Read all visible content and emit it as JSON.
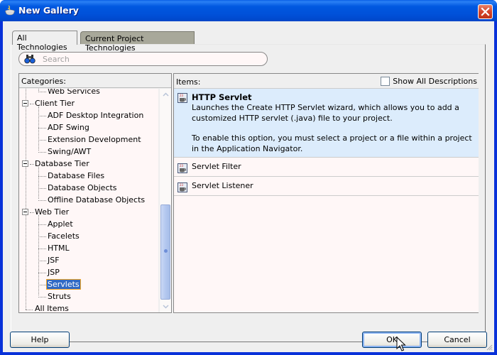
{
  "window": {
    "title": "New Gallery",
    "close_label": "close"
  },
  "tabs": [
    {
      "label": "All Technologies",
      "active": true
    },
    {
      "label": "Current Project Technologies",
      "active": false
    }
  ],
  "search": {
    "placeholder": "Search",
    "value": ""
  },
  "categories": {
    "header": "Categories:",
    "items": [
      {
        "label": "Web Services",
        "level": 1
      },
      {
        "label": "Client Tier",
        "level": 0,
        "expanded": true
      },
      {
        "label": "ADF Desktop Integration",
        "level": 1
      },
      {
        "label": "ADF Swing",
        "level": 1
      },
      {
        "label": "Extension Development",
        "level": 1
      },
      {
        "label": "Swing/AWT",
        "level": 1
      },
      {
        "label": "Database Tier",
        "level": 0,
        "expanded": true
      },
      {
        "label": "Database Files",
        "level": 1
      },
      {
        "label": "Database Objects",
        "level": 1
      },
      {
        "label": "Offline Database Objects",
        "level": 1
      },
      {
        "label": "Web Tier",
        "level": 0,
        "expanded": true
      },
      {
        "label": "Applet",
        "level": 1
      },
      {
        "label": "Facelets",
        "level": 1
      },
      {
        "label": "HTML",
        "level": 1
      },
      {
        "label": "JSF",
        "level": 1
      },
      {
        "label": "JSP",
        "level": 1
      },
      {
        "label": "Servlets",
        "level": 1,
        "selected": true
      },
      {
        "label": "Struts",
        "level": 1
      },
      {
        "label": "All Items",
        "level": 0
      }
    ]
  },
  "items": {
    "header": "Items:",
    "show_all_label": "Show All Descriptions",
    "show_all_checked": false,
    "list": [
      {
        "title": "HTTP Servlet",
        "selected": true,
        "description": [
          "Launches the Create HTTP Servlet wizard, which allows you to add a customized HTTP servlet (.java) file to your project.",
          "To enable this option, you must select a project or a file within a project in the Application Navigator."
        ]
      },
      {
        "title": "Servlet Filter",
        "selected": false
      },
      {
        "title": "Servlet Listener",
        "selected": false
      }
    ]
  },
  "buttons": {
    "help": "Help",
    "ok": "OK",
    "cancel": "Cancel"
  },
  "colors": {
    "titlebar": "#0054e3",
    "selection": "#316ac5",
    "selected_item_bg": "#dcecfc",
    "list_bg": "#fff7f7"
  }
}
